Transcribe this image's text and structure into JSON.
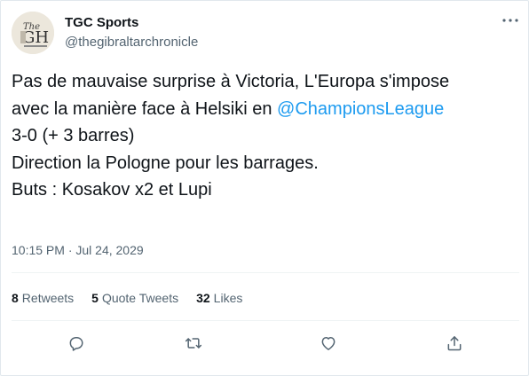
{
  "author": {
    "display_name": "TGC Sports",
    "handle": "@thegibraltarchronicle",
    "avatar_icon": "newspaper-logo-icon"
  },
  "tweet": {
    "line1": "Pas de mauvaise surprise à Victoria, L'Europa s'impose",
    "line2_prefix": "avec la manière face à Helsiki en ",
    "mention": "@ChampionsLeague",
    "line3": "3-0 (+ 3 barres)",
    "line4": "Direction la Pologne pour les barrages.",
    "line5": "Buts : Kosakov x2 et Lupi",
    "timestamp": "10:15 PM · Jul 24, 2029"
  },
  "stats": {
    "retweets_count": "8",
    "retweets_label": "Retweets",
    "quotes_count": "5",
    "quotes_label": "Quote Tweets",
    "likes_count": "32",
    "likes_label": "Likes"
  },
  "actions": [
    "reply-icon",
    "retweet-icon",
    "like-icon",
    "share-icon"
  ],
  "colors": {
    "mention": "#1d9bf0",
    "muted": "#536471",
    "text": "#0f1419"
  }
}
